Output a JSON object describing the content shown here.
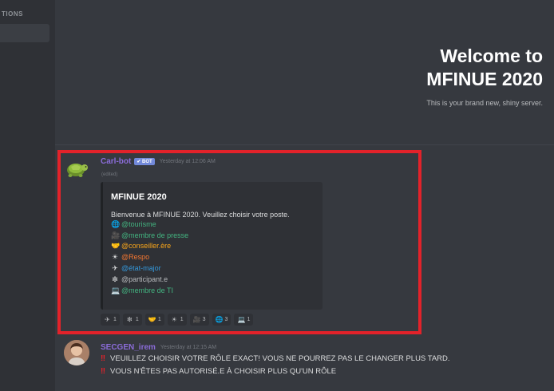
{
  "sidebar": {
    "section_label": "TIONS"
  },
  "welcome": {
    "line1": "Welcome to",
    "line2": "MFINUE 2020",
    "subtitle": "This is your brand new, shiny server."
  },
  "colors": {
    "highlight_border": "#e3222a",
    "bot_username": "#8b6cd9",
    "secgen_username": "#8b6cd9",
    "bot_tag": "#7289da"
  },
  "message1": {
    "username": "Carl-bot",
    "bot_tag": "✔ BOT",
    "timestamp": "Yesterday at 12:06 AM",
    "edited": "(edited)",
    "embed": {
      "title": "MFINUE 2020",
      "description": "Bienvenue à MFINUE 2020. Veuillez choisir votre poste.",
      "roles": [
        {
          "icon": "globe-icon",
          "glyph": "🌐",
          "label": "@tourisme",
          "color": "#43b581"
        },
        {
          "icon": "camera-icon",
          "glyph": "🎥",
          "label": "@membre de presse",
          "color": "#43b581"
        },
        {
          "icon": "handshake-icon",
          "glyph": "🤝",
          "label": "@conseiller.ère",
          "color": "#faa61a"
        },
        {
          "icon": "sun-icon",
          "glyph": "☀",
          "label": "@Respo",
          "color": "#f57731"
        },
        {
          "icon": "plane-icon",
          "glyph": "✈",
          "label": "@état-major",
          "color": "#3498db"
        },
        {
          "icon": "sparkle-icon",
          "glyph": "❇",
          "label": "@participant.e",
          "color": "#b9bbbe"
        },
        {
          "icon": "computer-icon",
          "glyph": "💻",
          "label": "@membre de TI",
          "color": "#43b581"
        }
      ]
    },
    "reactions": [
      {
        "icon": "plane-icon",
        "glyph": "✈",
        "count": "1"
      },
      {
        "icon": "sparkle-icon",
        "glyph": "❇",
        "count": "1"
      },
      {
        "icon": "handshake-icon",
        "glyph": "🤝",
        "count": "1"
      },
      {
        "icon": "sun-icon",
        "glyph": "☀",
        "count": "1"
      },
      {
        "icon": "camera-icon",
        "glyph": "🎥",
        "count": "3"
      },
      {
        "icon": "globe-icon",
        "glyph": "🌐",
        "count": "3"
      },
      {
        "icon": "computer-icon",
        "glyph": "💻",
        "count": "1"
      }
    ]
  },
  "message2": {
    "username": "SECGEN_irem",
    "timestamp": "Yesterday at 12:15 AM",
    "line1_icon": "‼",
    "line1": "VEUILLEZ CHOISIR VOTRE RÔLE EXACT! VOUS NE POURREZ PAS LE CHANGER PLUS TARD.",
    "line2_icon": "‼",
    "line2": "VOUS N'ÊTES PAS AUTORISÉ.E À CHOISIR PLUS QU'UN RÔLE"
  }
}
